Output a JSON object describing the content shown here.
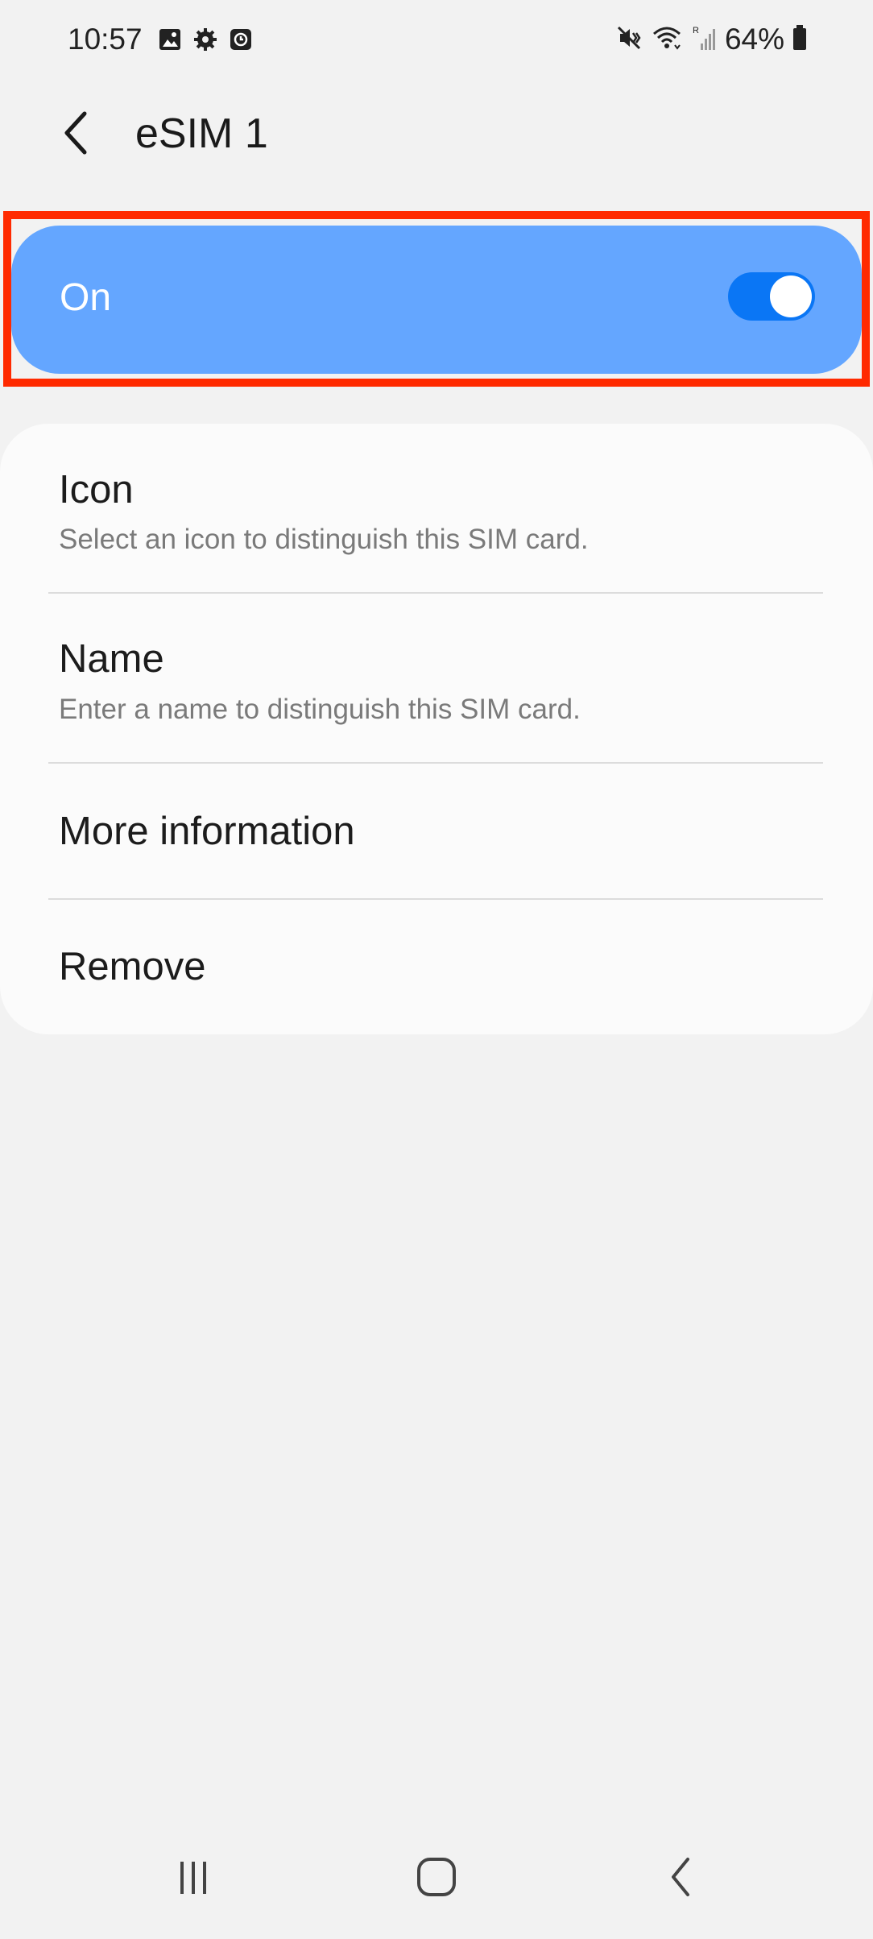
{
  "status_bar": {
    "time": "10:57",
    "battery": "64%",
    "left_icons": [
      "gallery-icon",
      "settings-gear-icon",
      "clock-app-icon"
    ],
    "right_icons": [
      "mute-vibrate-icon",
      "wifi-icon",
      "signal-roaming-icon",
      "battery-icon"
    ]
  },
  "header": {
    "title": "eSIM 1",
    "back_icon": "back-arrow-icon"
  },
  "toggle": {
    "label": "On",
    "state": "on"
  },
  "settings": {
    "icon": {
      "title": "Icon",
      "subtitle": "Select an icon to distinguish this SIM card."
    },
    "name": {
      "title": "Name",
      "subtitle": "Enter a name to distinguish this SIM card."
    },
    "more_info": {
      "title": "More information"
    },
    "remove": {
      "title": "Remove"
    }
  },
  "nav_bar": {
    "items": [
      "recent-apps-icon",
      "home-icon",
      "back-icon"
    ]
  },
  "colors": {
    "background": "#f2f2f2",
    "toggle_card": "#64a6ff",
    "switch_track": "#0a76f5",
    "highlight": "#ff2a00",
    "list_card": "#fbfbfb"
  }
}
